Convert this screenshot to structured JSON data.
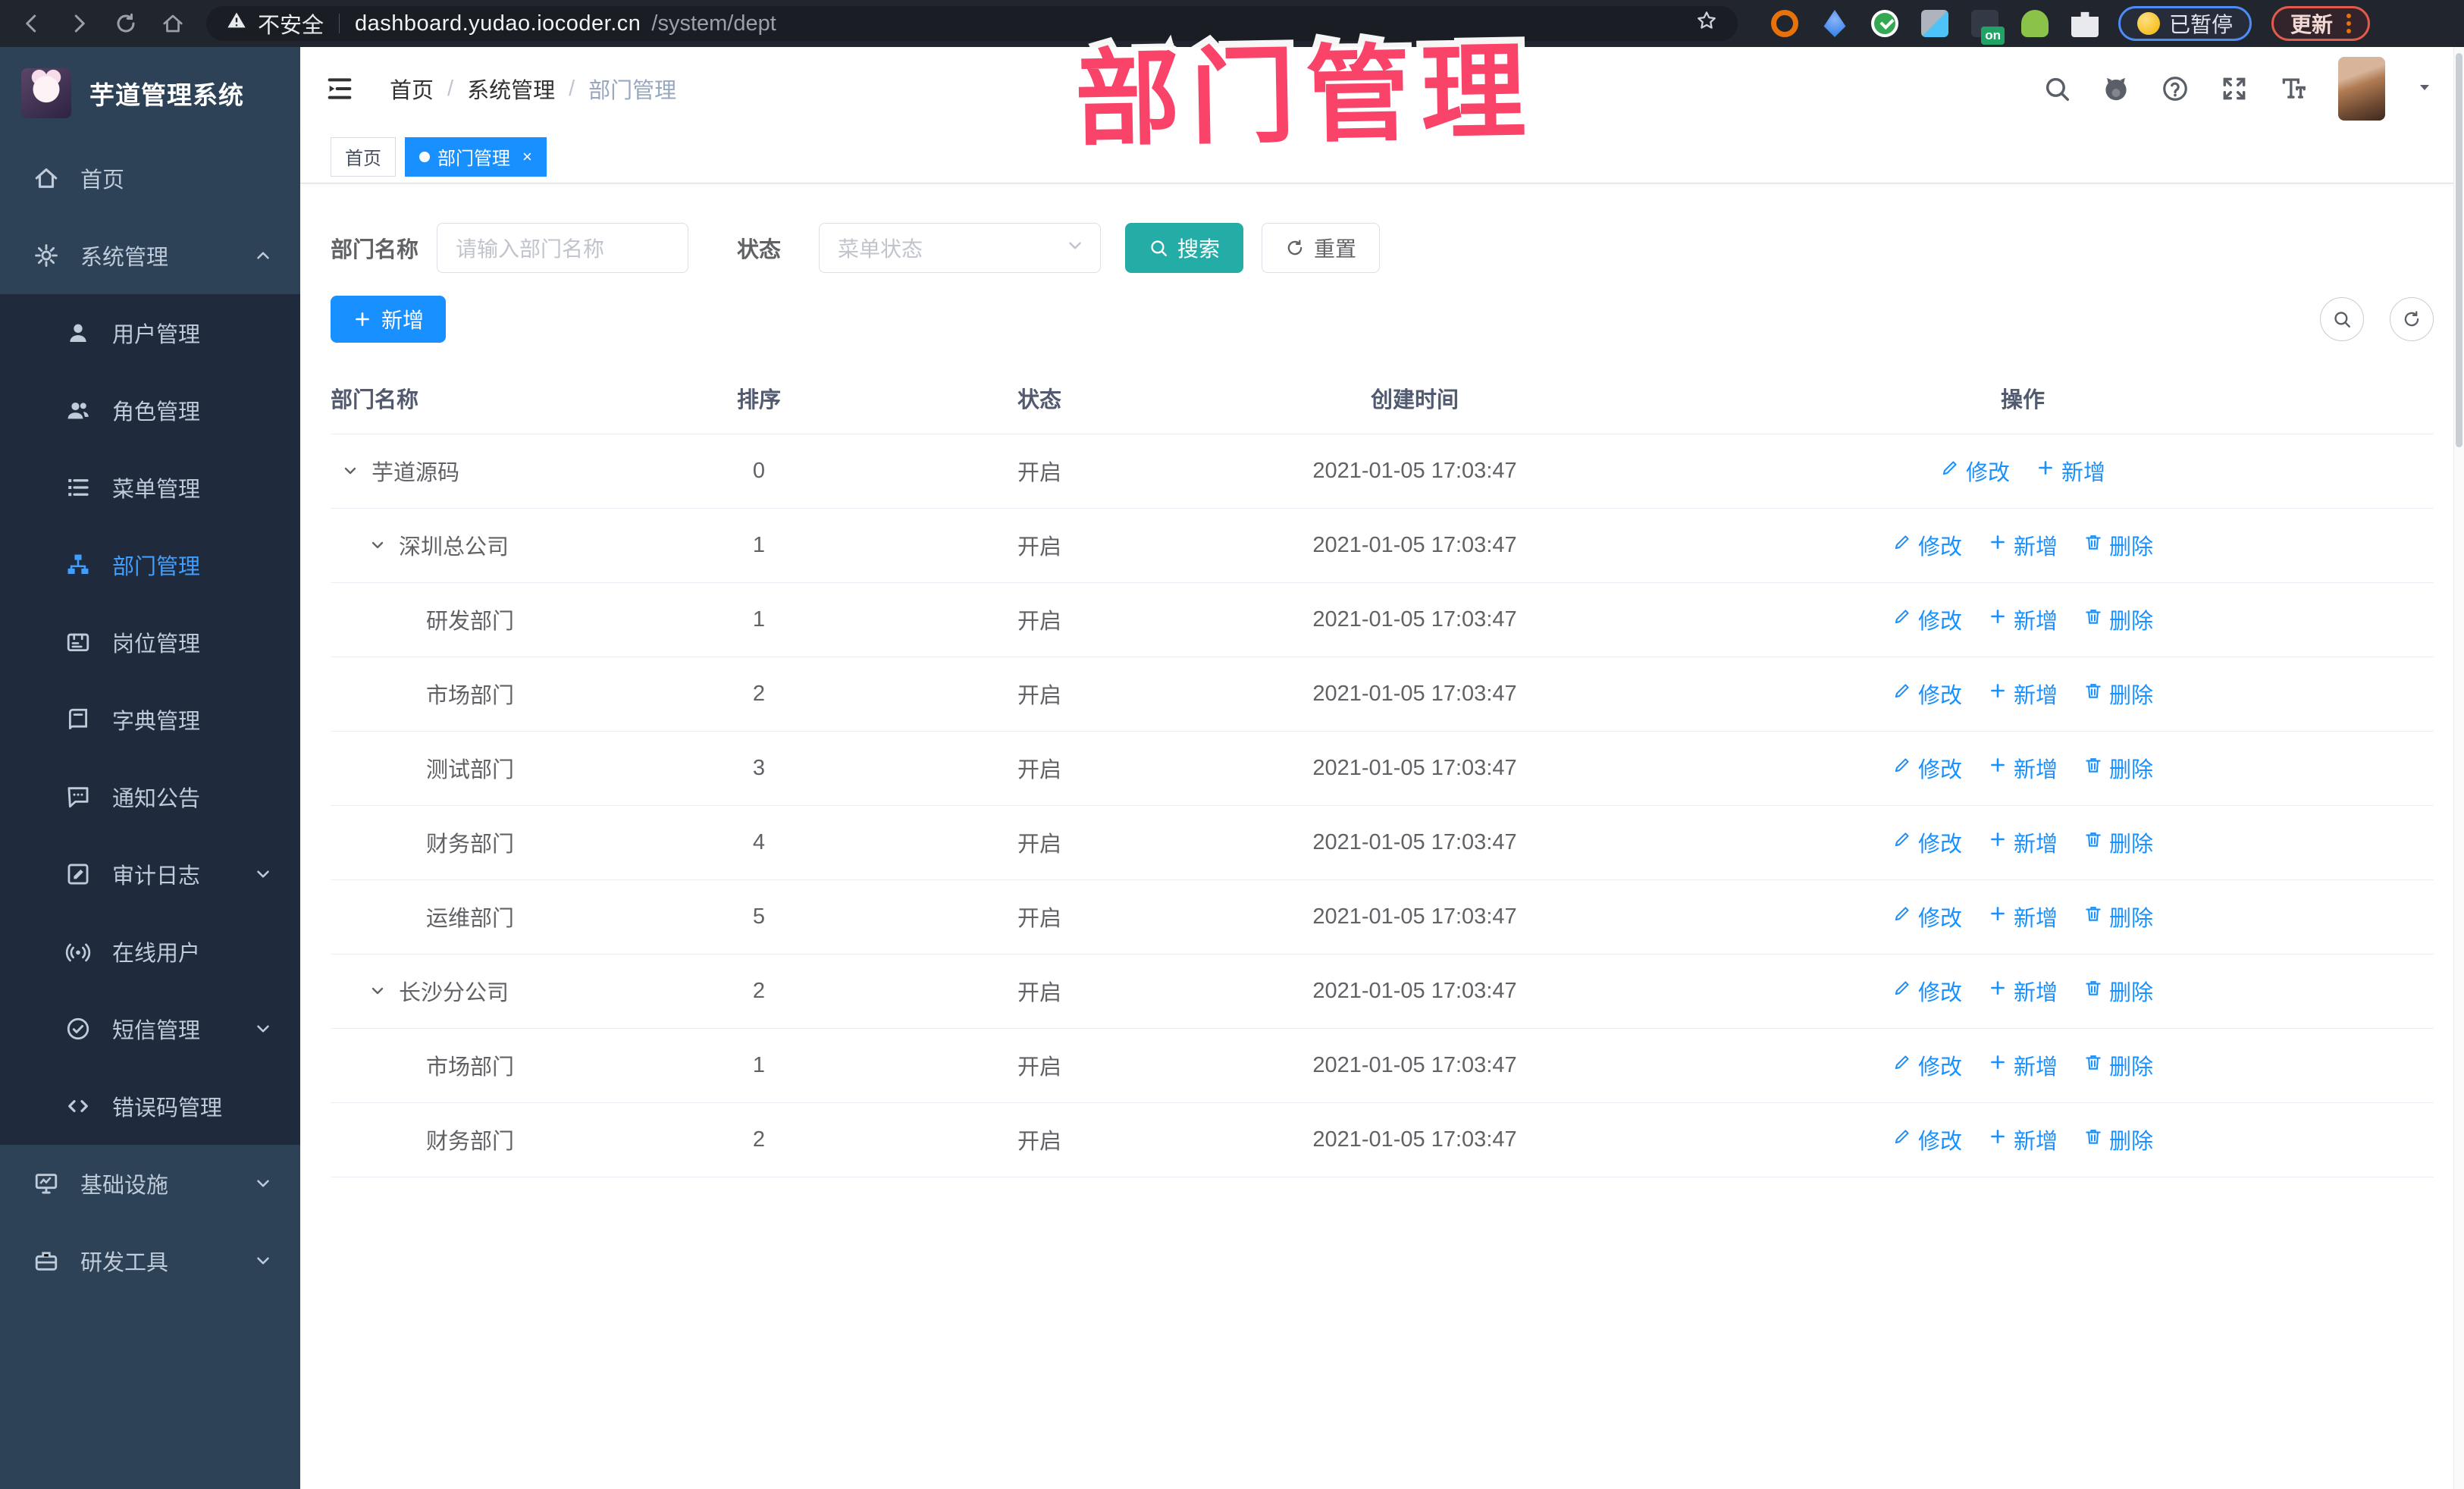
{
  "browser": {
    "security_label": "不安全",
    "url_domain": "dashboard.yudao.iocoder.cn",
    "url_path": "/system/dept",
    "paused_badge": "已暂停",
    "update_button": "更新",
    "ext_on_badge": "on"
  },
  "overlay": {
    "title": "部门管理",
    "color": "#fa4368"
  },
  "sidebar": {
    "app_title": "芋道管理系统",
    "items": [
      {
        "icon": "home",
        "label": "首页",
        "level": 0
      },
      {
        "icon": "gear",
        "label": "系统管理",
        "level": 0,
        "chevron": "up"
      },
      {
        "icon": "user",
        "label": "用户管理",
        "level": 1
      },
      {
        "icon": "users",
        "label": "角色管理",
        "level": 1
      },
      {
        "icon": "list",
        "label": "菜单管理",
        "level": 1
      },
      {
        "icon": "org",
        "label": "部门管理",
        "level": 1,
        "active": true
      },
      {
        "icon": "badge",
        "label": "岗位管理",
        "level": 1
      },
      {
        "icon": "book",
        "label": "字典管理",
        "level": 1
      },
      {
        "icon": "chat",
        "label": "通知公告",
        "level": 1
      },
      {
        "icon": "editlog",
        "label": "审计日志",
        "level": 1,
        "chevron": "down"
      },
      {
        "icon": "online",
        "label": "在线用户",
        "level": 1
      },
      {
        "icon": "sms",
        "label": "短信管理",
        "level": 1,
        "chevron": "down"
      },
      {
        "icon": "code",
        "label": "错误码管理",
        "level": 1
      },
      {
        "icon": "infra",
        "label": "基础设施",
        "level": 0,
        "chevron": "down"
      },
      {
        "icon": "tools",
        "label": "研发工具",
        "level": 0,
        "chevron": "down"
      }
    ]
  },
  "breadcrumb": [
    "首页",
    "系统管理",
    "部门管理"
  ],
  "tabs": [
    {
      "label": "首页",
      "active": false,
      "closable": false
    },
    {
      "label": "部门管理",
      "active": true,
      "closable": true
    }
  ],
  "filters": {
    "dept_name_label": "部门名称",
    "dept_name_placeholder": "请输入部门名称",
    "status_label": "状态",
    "status_placeholder": "菜单状态",
    "search_label": "搜索",
    "reset_label": "重置"
  },
  "toolbar": {
    "add_label": "新增"
  },
  "table": {
    "headers": [
      "部门名称",
      "排序",
      "状态",
      "创建时间",
      "操作"
    ],
    "rows": [
      {
        "name": "芋道源码",
        "level": 0,
        "expandable": true,
        "sort": "0",
        "status": "开启",
        "created": "2021-01-05 17:03:47",
        "actions": [
          {
            "label": "修改",
            "icon": "pencil"
          },
          {
            "label": "新增",
            "icon": "plus"
          }
        ]
      },
      {
        "name": "深圳总公司",
        "level": 1,
        "expandable": true,
        "sort": "1",
        "status": "开启",
        "created": "2021-01-05 17:03:47",
        "actions": [
          {
            "label": "修改",
            "icon": "pencil"
          },
          {
            "label": "新增",
            "icon": "plus"
          },
          {
            "label": "删除",
            "icon": "trash"
          }
        ]
      },
      {
        "name": "研发部门",
        "level": 2,
        "expandable": false,
        "sort": "1",
        "status": "开启",
        "created": "2021-01-05 17:03:47",
        "actions": [
          {
            "label": "修改",
            "icon": "pencil"
          },
          {
            "label": "新增",
            "icon": "plus"
          },
          {
            "label": "删除",
            "icon": "trash"
          }
        ]
      },
      {
        "name": "市场部门",
        "level": 2,
        "expandable": false,
        "sort": "2",
        "status": "开启",
        "created": "2021-01-05 17:03:47",
        "actions": [
          {
            "label": "修改",
            "icon": "pencil"
          },
          {
            "label": "新增",
            "icon": "plus"
          },
          {
            "label": "删除",
            "icon": "trash"
          }
        ]
      },
      {
        "name": "测试部门",
        "level": 2,
        "expandable": false,
        "sort": "3",
        "status": "开启",
        "created": "2021-01-05 17:03:47",
        "actions": [
          {
            "label": "修改",
            "icon": "pencil"
          },
          {
            "label": "新增",
            "icon": "plus"
          },
          {
            "label": "删除",
            "icon": "trash"
          }
        ]
      },
      {
        "name": "财务部门",
        "level": 2,
        "expandable": false,
        "sort": "4",
        "status": "开启",
        "created": "2021-01-05 17:03:47",
        "actions": [
          {
            "label": "修改",
            "icon": "pencil"
          },
          {
            "label": "新增",
            "icon": "plus"
          },
          {
            "label": "删除",
            "icon": "trash"
          }
        ]
      },
      {
        "name": "运维部门",
        "level": 2,
        "expandable": false,
        "sort": "5",
        "status": "开启",
        "created": "2021-01-05 17:03:47",
        "actions": [
          {
            "label": "修改",
            "icon": "pencil"
          },
          {
            "label": "新增",
            "icon": "plus"
          },
          {
            "label": "删除",
            "icon": "trash"
          }
        ]
      },
      {
        "name": "长沙分公司",
        "level": 1,
        "expandable": true,
        "sort": "2",
        "status": "开启",
        "created": "2021-01-05 17:03:47",
        "actions": [
          {
            "label": "修改",
            "icon": "pencil"
          },
          {
            "label": "新增",
            "icon": "plus"
          },
          {
            "label": "删除",
            "icon": "trash"
          }
        ]
      },
      {
        "name": "市场部门",
        "level": 2,
        "expandable": false,
        "sort": "1",
        "status": "开启",
        "created": "2021-01-05 17:03:47",
        "actions": [
          {
            "label": "修改",
            "icon": "pencil"
          },
          {
            "label": "新增",
            "icon": "plus"
          },
          {
            "label": "删除",
            "icon": "trash"
          }
        ]
      },
      {
        "name": "财务部门",
        "level": 2,
        "expandable": false,
        "sort": "2",
        "status": "开启",
        "created": "2021-01-05 17:03:47",
        "actions": [
          {
            "label": "修改",
            "icon": "pencil"
          },
          {
            "label": "新增",
            "icon": "plus"
          },
          {
            "label": "删除",
            "icon": "trash"
          }
        ]
      }
    ]
  },
  "colors": {
    "primary_blue": "#1890ff",
    "active_menu_blue": "#409eff",
    "search_teal": "#23ada6",
    "sidebar_bg": "#2d4257",
    "submenu_bg": "#1f2a3d",
    "overlay_pink": "#fa4368"
  }
}
